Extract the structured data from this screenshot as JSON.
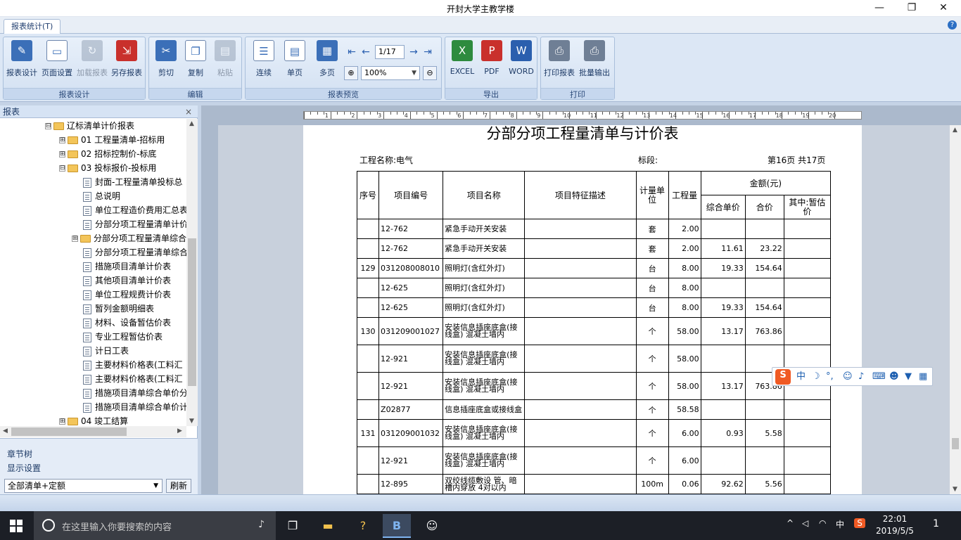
{
  "window": {
    "title": "开封大学主教学楼",
    "minimize": "—",
    "maximize": "❐",
    "close": "✕"
  },
  "tabs": {
    "active": "报表统计(T)",
    "help": "?"
  },
  "ribbon": {
    "groups": {
      "design": "报表设计",
      "edit": "编辑",
      "preview": "报表预览",
      "export": "导出",
      "print": "打印"
    },
    "buttons": {
      "report_design": "报表设计",
      "page_setup": "页面设置",
      "load_report": "加载报表",
      "save_as": "另存报表",
      "cut": "剪切",
      "copy": "复制",
      "paste": "粘贴",
      "continuous": "连续",
      "single_page": "单页",
      "multi_page": "多页",
      "excel": "EXCEL",
      "pdf": "PDF",
      "word": "WORD",
      "print_report": "打印报表",
      "batch_output": "批量输出"
    },
    "page_indicator": "1/17",
    "zoom": "100%"
  },
  "left_panel": {
    "title": "报表",
    "close": "×",
    "tree": [
      {
        "label": "辽标清单计价报表",
        "type": "folder",
        "expander": "⊟",
        "level": 0
      },
      {
        "label": "01 工程量清单-招标用",
        "type": "folder",
        "expander": "⊞",
        "level": 1
      },
      {
        "label": "02 招标控制价-标底",
        "type": "folder",
        "expander": "⊞",
        "level": 1
      },
      {
        "label": "03 投标报价-投标用",
        "type": "folder",
        "expander": "⊟",
        "level": 1
      },
      {
        "label": "封面-工程量清单投标总",
        "type": "doc",
        "level": 2
      },
      {
        "label": "总说明",
        "type": "doc",
        "level": 2
      },
      {
        "label": "单位工程造价费用汇总表",
        "type": "doc",
        "level": 2
      },
      {
        "label": "分部分项工程量清单计价",
        "type": "doc",
        "level": 2
      },
      {
        "label": "分部分项工程量清单综合",
        "type": "folder",
        "expander": "⊞",
        "level": 2
      },
      {
        "label": "分部分项工程量清单综合",
        "type": "doc",
        "level": 2
      },
      {
        "label": "措施项目清单计价表",
        "type": "doc",
        "level": 2
      },
      {
        "label": "其他项目清单计价表",
        "type": "doc",
        "level": 2
      },
      {
        "label": "单位工程规费计价表",
        "type": "doc",
        "level": 2
      },
      {
        "label": "暂列金额明细表",
        "type": "doc",
        "level": 2
      },
      {
        "label": "材料、设备暂估价表",
        "type": "doc",
        "level": 2
      },
      {
        "label": "专业工程暂估价表",
        "type": "doc",
        "level": 2
      },
      {
        "label": "计日工表",
        "type": "doc",
        "level": 2
      },
      {
        "label": "主要材料价格表(工料汇",
        "type": "doc",
        "level": 2
      },
      {
        "label": "主要材料价格表(工料汇",
        "type": "doc",
        "level": 2
      },
      {
        "label": "措施项目清单综合单价分",
        "type": "doc",
        "level": 2
      },
      {
        "label": "措施项目清单综合单价计",
        "type": "doc",
        "level": 2
      },
      {
        "label": "04 竣工结算",
        "type": "folder",
        "expander": "⊞",
        "level": 1
      }
    ],
    "chapter_tree": "章节树",
    "display_settings": "显示设置",
    "filter_value": "全部清单+定额",
    "refresh": "刷新"
  },
  "report": {
    "title": "分部分项工程量清单与计价表",
    "project_label": "工程名称:电气",
    "section_label": "标段:",
    "page_label": "第16页  共17页",
    "headers": {
      "seq": "序号",
      "code": "项目编号",
      "name": "项目名称",
      "desc": "项目特征描述",
      "unit": "计量单位",
      "qty": "工程量",
      "amount": "金额(元)",
      "unit_price": "综合单价",
      "total": "合价",
      "provisional": "其中:暂估价"
    },
    "rows": [
      {
        "seq": "",
        "code": "12-762",
        "name": "紧急手动开关安装",
        "desc": "",
        "unit": "套",
        "qty": "2.00",
        "price": "",
        "total": "",
        "prov": ""
      },
      {
        "seq": "",
        "code": "12-762",
        "name": "紧急手动开关安装",
        "desc": "",
        "unit": "套",
        "qty": "2.00",
        "price": "11.61",
        "total": "23.22",
        "prov": ""
      },
      {
        "seq": "129",
        "code": "031208008010",
        "name": "照明灯(含红外灯)",
        "desc": "",
        "unit": "台",
        "qty": "8.00",
        "price": "19.33",
        "total": "154.64",
        "prov": ""
      },
      {
        "seq": "",
        "code": "12-625",
        "name": "照明灯(含红外灯)",
        "desc": "",
        "unit": "台",
        "qty": "8.00",
        "price": "",
        "total": "",
        "prov": ""
      },
      {
        "seq": "",
        "code": "12-625",
        "name": "照明灯(含红外灯)",
        "desc": "",
        "unit": "台",
        "qty": "8.00",
        "price": "19.33",
        "total": "154.64",
        "prov": ""
      },
      {
        "seq": "130",
        "code": "031209001027",
        "name": "安装信息插座底盒(接线盒) 混凝土墙内",
        "desc": "",
        "unit": "个",
        "qty": "58.00",
        "price": "13.17",
        "total": "763.86",
        "prov": ""
      },
      {
        "seq": "",
        "code": "12-921",
        "name": "安装信息插座底盒(接线盒) 混凝土墙内",
        "desc": "",
        "unit": "个",
        "qty": "58.00",
        "price": "",
        "total": "",
        "prov": ""
      },
      {
        "seq": "",
        "code": "12-921",
        "name": "安装信息插座底盒(接线盒) 混凝土墙内",
        "desc": "",
        "unit": "个",
        "qty": "58.00",
        "price": "13.17",
        "total": "763.86",
        "prov": ""
      },
      {
        "seq": "",
        "code": "Z02877",
        "name": "信息插座底盒或接线盒",
        "desc": "",
        "unit": "个",
        "qty": "58.58",
        "price": "",
        "total": "",
        "prov": ""
      },
      {
        "seq": "131",
        "code": "031209001032",
        "name": "安装信息插座底盒(接线盒) 混凝土墙内",
        "desc": "",
        "unit": "个",
        "qty": "6.00",
        "price": "0.93",
        "total": "5.58",
        "prov": ""
      },
      {
        "seq": "",
        "code": "12-921",
        "name": "安装信息插座底盒(接线盒) 混凝土墙内",
        "desc": "",
        "unit": "个",
        "qty": "6.00",
        "price": "",
        "total": "",
        "prov": ""
      },
      {
        "seq": "",
        "code": "12-895",
        "name": "双绞线缆敷设 管、暗槽内穿放 4对以内",
        "desc": "",
        "unit": "100m",
        "qty": "0.06",
        "price": "92.62",
        "total": "5.56",
        "prov": ""
      }
    ]
  },
  "ruler": {
    "numbers": [
      "1",
      "2",
      "3",
      "4",
      "5",
      "6",
      "7",
      "8",
      "9",
      "10",
      "11",
      "12",
      "13",
      "14",
      "15",
      "16",
      "17",
      "18",
      "19",
      "20"
    ]
  },
  "ime": {
    "logo": "S",
    "lang": "中",
    "moon": "☽",
    "punct": "°,",
    "smile": "☺",
    "mic": "♪",
    "keyboard": "⌨",
    "user": "☻",
    "shirt": "▼",
    "grid": "▦"
  },
  "taskbar": {
    "search_placeholder": "在这里输入你要搜索的内容",
    "mic": "♪",
    "task_view": "❐",
    "explorer": "▬",
    "app_help": "?",
    "app_active": "B",
    "app_avatar": "☺",
    "tray_arrow": "^",
    "tray_ime_lang": "中",
    "tray_ime_logo": "S",
    "tray_network": "◠",
    "tray_volume": "◁",
    "time": "22:01",
    "date": "2019/5/5",
    "notif_count": "1"
  },
  "colors": {
    "ribbon_bg": "#dce7f5",
    "accent": "#2c6fc4",
    "taskbar": "#1c1f26"
  }
}
